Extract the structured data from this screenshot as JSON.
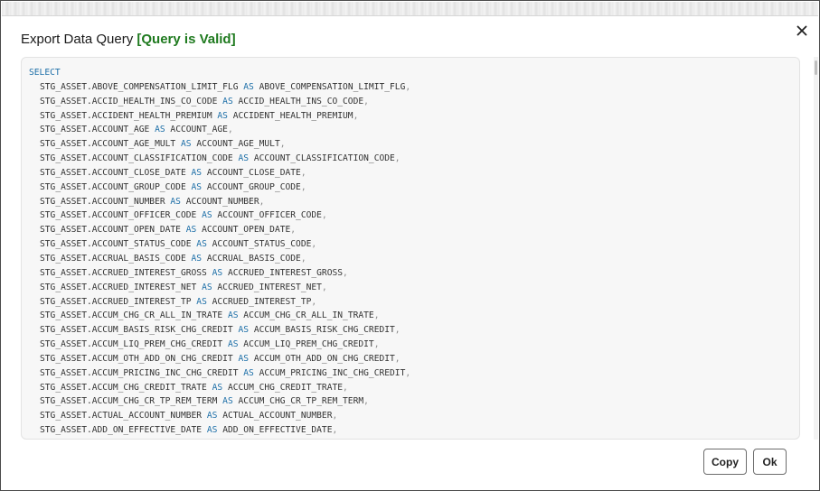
{
  "dialog": {
    "title": "Export Data Query",
    "status": "[Query is Valid]",
    "close_icon": "close-icon",
    "copy_label": "Copy",
    "ok_label": "Ok"
  },
  "query": {
    "select_keyword": "SELECT",
    "as_keyword": "AS",
    "lines": [
      {
        "expr": "STG_ASSET.ABOVE_COMPENSATION_LIMIT_FLG",
        "alias": "ABOVE_COMPENSATION_LIMIT_FLG",
        "sep": ","
      },
      {
        "expr": "STG_ASSET.ACCID_HEALTH_INS_CO_CODE",
        "alias": "ACCID_HEALTH_INS_CO_CODE",
        "sep": ","
      },
      {
        "expr": "STG_ASSET.ACCIDENT_HEALTH_PREMIUM",
        "alias": "ACCIDENT_HEALTH_PREMIUM",
        "sep": ","
      },
      {
        "expr": "STG_ASSET.ACCOUNT_AGE",
        "alias": "ACCOUNT_AGE",
        "sep": ","
      },
      {
        "expr": "STG_ASSET.ACCOUNT_AGE_MULT",
        "alias": "ACCOUNT_AGE_MULT",
        "sep": ","
      },
      {
        "expr": "STG_ASSET.ACCOUNT_CLASSIFICATION_CODE",
        "alias": "ACCOUNT_CLASSIFICATION_CODE",
        "sep": ","
      },
      {
        "expr": "STG_ASSET.ACCOUNT_CLOSE_DATE",
        "alias": "ACCOUNT_CLOSE_DATE",
        "sep": ","
      },
      {
        "expr": "STG_ASSET.ACCOUNT_GROUP_CODE",
        "alias": "ACCOUNT_GROUP_CODE",
        "sep": ","
      },
      {
        "expr": "STG_ASSET.ACCOUNT_NUMBER",
        "alias": "ACCOUNT_NUMBER",
        "sep": ","
      },
      {
        "expr": "STG_ASSET.ACCOUNT_OFFICER_CODE",
        "alias": "ACCOUNT_OFFICER_CODE",
        "sep": ","
      },
      {
        "expr": "STG_ASSET.ACCOUNT_OPEN_DATE",
        "alias": "ACCOUNT_OPEN_DATE",
        "sep": ","
      },
      {
        "expr": "STG_ASSET.ACCOUNT_STATUS_CODE",
        "alias": "ACCOUNT_STATUS_CODE",
        "sep": ","
      },
      {
        "expr": "STG_ASSET.ACCRUAL_BASIS_CODE",
        "alias": "ACCRUAL_BASIS_CODE",
        "sep": ","
      },
      {
        "expr": "STG_ASSET.ACCRUED_INTEREST_GROSS",
        "alias": "ACCRUED_INTEREST_GROSS",
        "sep": ","
      },
      {
        "expr": "STG_ASSET.ACCRUED_INTEREST_NET",
        "alias": "ACCRUED_INTEREST_NET",
        "sep": ","
      },
      {
        "expr": "STG_ASSET.ACCRUED_INTEREST_TP",
        "alias": "ACCRUED_INTEREST_TP",
        "sep": ","
      },
      {
        "expr": "STG_ASSET.ACCUM_CHG_CR_ALL_IN_TRATE",
        "alias": "ACCUM_CHG_CR_ALL_IN_TRATE",
        "sep": ","
      },
      {
        "expr": "STG_ASSET.ACCUM_BASIS_RISK_CHG_CREDIT",
        "alias": "ACCUM_BASIS_RISK_CHG_CREDIT",
        "sep": ","
      },
      {
        "expr": "STG_ASSET.ACCUM_LIQ_PREM_CHG_CREDIT",
        "alias": "ACCUM_LIQ_PREM_CHG_CREDIT",
        "sep": ","
      },
      {
        "expr": "STG_ASSET.ACCUM_OTH_ADD_ON_CHG_CREDIT",
        "alias": "ACCUM_OTH_ADD_ON_CHG_CREDIT",
        "sep": ","
      },
      {
        "expr": "STG_ASSET.ACCUM_PRICING_INC_CHG_CREDIT",
        "alias": "ACCUM_PRICING_INC_CHG_CREDIT",
        "sep": ","
      },
      {
        "expr": "STG_ASSET.ACCUM_CHG_CREDIT_TRATE",
        "alias": "ACCUM_CHG_CREDIT_TRATE",
        "sep": ","
      },
      {
        "expr": "STG_ASSET.ACCUM_CHG_CR_TP_REM_TERM",
        "alias": "ACCUM_CHG_CR_TP_REM_TERM",
        "sep": ","
      },
      {
        "expr": "STG_ASSET.ACTUAL_ACCOUNT_NUMBER",
        "alias": "ACTUAL_ACCOUNT_NUMBER",
        "sep": ","
      },
      {
        "expr": "STG_ASSET.ADD_ON_EFFECTIVE_DATE",
        "alias": "ADD_ON_EFFECTIVE_DATE",
        "sep": ","
      }
    ]
  },
  "colors": {
    "keyword": "#1d6fa8",
    "valid_status": "#1f7a1f"
  }
}
